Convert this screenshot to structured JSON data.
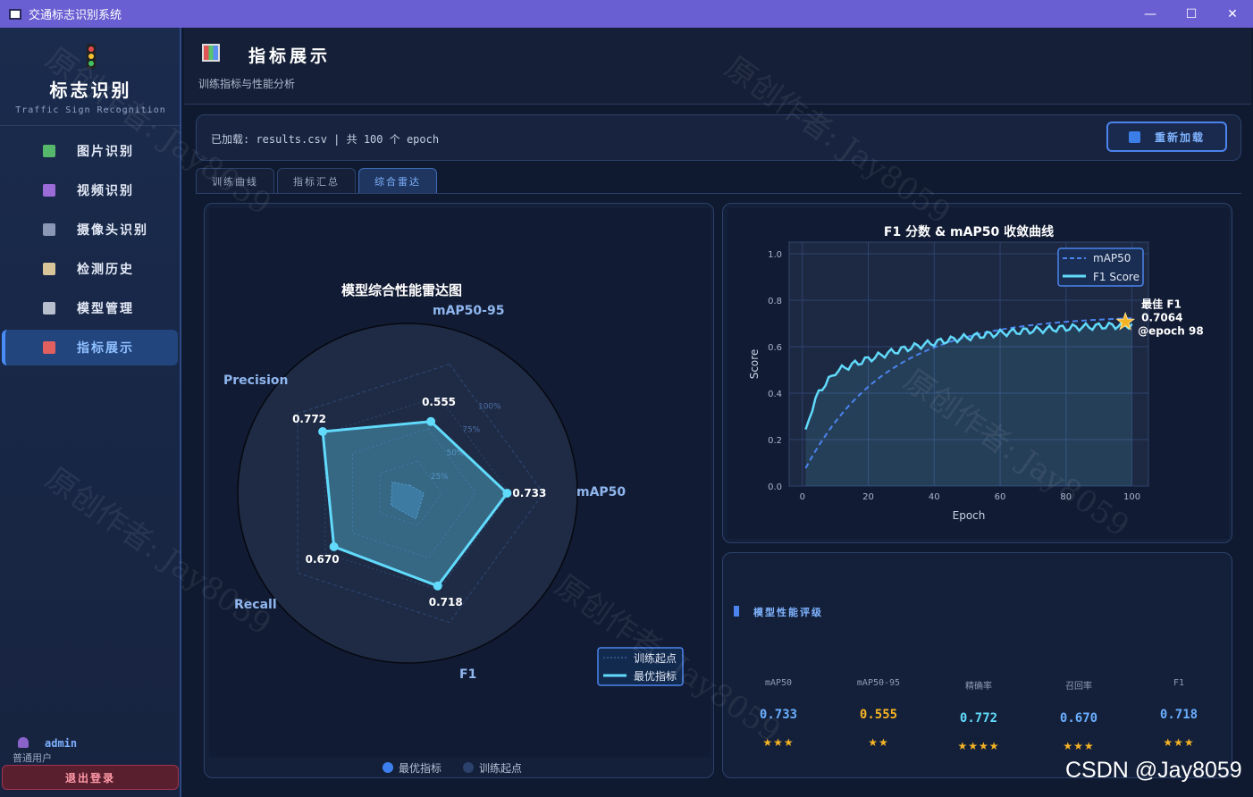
{
  "window": {
    "title": "交通标志识别系统",
    "minimize": "—",
    "maximize": "☐",
    "close": "✕"
  },
  "sidebar": {
    "logo_title": "标志识别",
    "logo_subtitle": "Traffic Sign Recognition",
    "items": [
      {
        "label": "图片识别",
        "icon": "image-icon",
        "color": "#56b86a"
      },
      {
        "label": "视频识别",
        "icon": "clapper-icon",
        "color": "#9b6cd8"
      },
      {
        "label": "摄像头识别",
        "icon": "camera-icon",
        "color": "#8a98b5"
      },
      {
        "label": "检测历史",
        "icon": "clipboard-icon",
        "color": "#d8c69a"
      },
      {
        "label": "模型管理",
        "icon": "gear-icon",
        "color": "#b7bfcf"
      },
      {
        "label": "指标展示",
        "icon": "bar-chart-icon",
        "color": "#e06060",
        "active": true
      }
    ],
    "user": {
      "name": "admin",
      "role": "普通用户"
    },
    "logout_label": "退出登录"
  },
  "header": {
    "title": "指标展示",
    "subtitle": "训练指标与性能分析"
  },
  "infobar": {
    "text": "已加载: results.csv  |  共 100 个 epoch",
    "reload_label": "重新加载"
  },
  "tabs": [
    {
      "label": "训练曲线",
      "active": false
    },
    {
      "label": "指标汇总",
      "active": false
    },
    {
      "label": "综合雷达",
      "active": true
    }
  ],
  "rating": {
    "title": "模型性能评级",
    "metrics": [
      {
        "label": "mAP50",
        "value": "0.733",
        "stars": "★★★",
        "color": "#6aaeff"
      },
      {
        "label": "mAP50-95",
        "value": "0.555",
        "stars": "★★",
        "color": "#f5b324"
      },
      {
        "label": "精确率",
        "value": "0.772",
        "stars": "★★★★",
        "color": "#61dafb"
      },
      {
        "label": "召回率",
        "value": "0.670",
        "stars": "★★★",
        "color": "#6aaeff"
      },
      {
        "label": "F1",
        "value": "0.718",
        "stars": "★★★",
        "color": "#6aaeff"
      }
    ]
  },
  "watermark_text": "原创作者: Jay8059",
  "csdn_mark": "CSDN @Jay8059",
  "chart_data": [
    {
      "type": "radar",
      "title": "模型综合性能雷达图",
      "axes": [
        "mAP50-95",
        "mAP50",
        "F1",
        "Recall",
        "Precision"
      ],
      "series": [
        {
          "name": "训练起点",
          "values": [
            0.06,
            0.12,
            0.2,
            0.15,
            0.14
          ]
        },
        {
          "name": "最优指标",
          "values": [
            0.555,
            0.733,
            0.718,
            0.67,
            0.772
          ]
        }
      ],
      "value_labels": [
        "0.555",
        "0.733",
        "0.718",
        "0.670",
        "0.772"
      ],
      "ring_labels": [
        "25%",
        "50%",
        "75%",
        "100%"
      ],
      "legend": [
        "训练起点",
        "最优指标"
      ],
      "bottom_legend": [
        "最优指标",
        "训练起点"
      ]
    },
    {
      "type": "line",
      "title": "F1 分数 & mAP50 收敛曲线",
      "xlabel": "Epoch",
      "ylabel": "Score",
      "xlim": [
        -4,
        105
      ],
      "ylim": [
        0,
        1.05
      ],
      "xticks": [
        0,
        20,
        40,
        60,
        80,
        100
      ],
      "yticks": [
        0.0,
        0.2,
        0.4,
        0.6,
        0.8,
        1.0
      ],
      "legend": [
        "mAP50",
        "F1 Score"
      ],
      "annotation": {
        "lines": [
          "最佳 F1",
          "0.7064",
          "@epoch 98"
        ],
        "epoch": 98,
        "value": 0.7064
      },
      "series": [
        {
          "name": "mAP50",
          "curve": "map",
          "final": 0.733
        },
        {
          "name": "F1 Score",
          "curve": "f1",
          "final": 0.7064
        }
      ]
    }
  ]
}
